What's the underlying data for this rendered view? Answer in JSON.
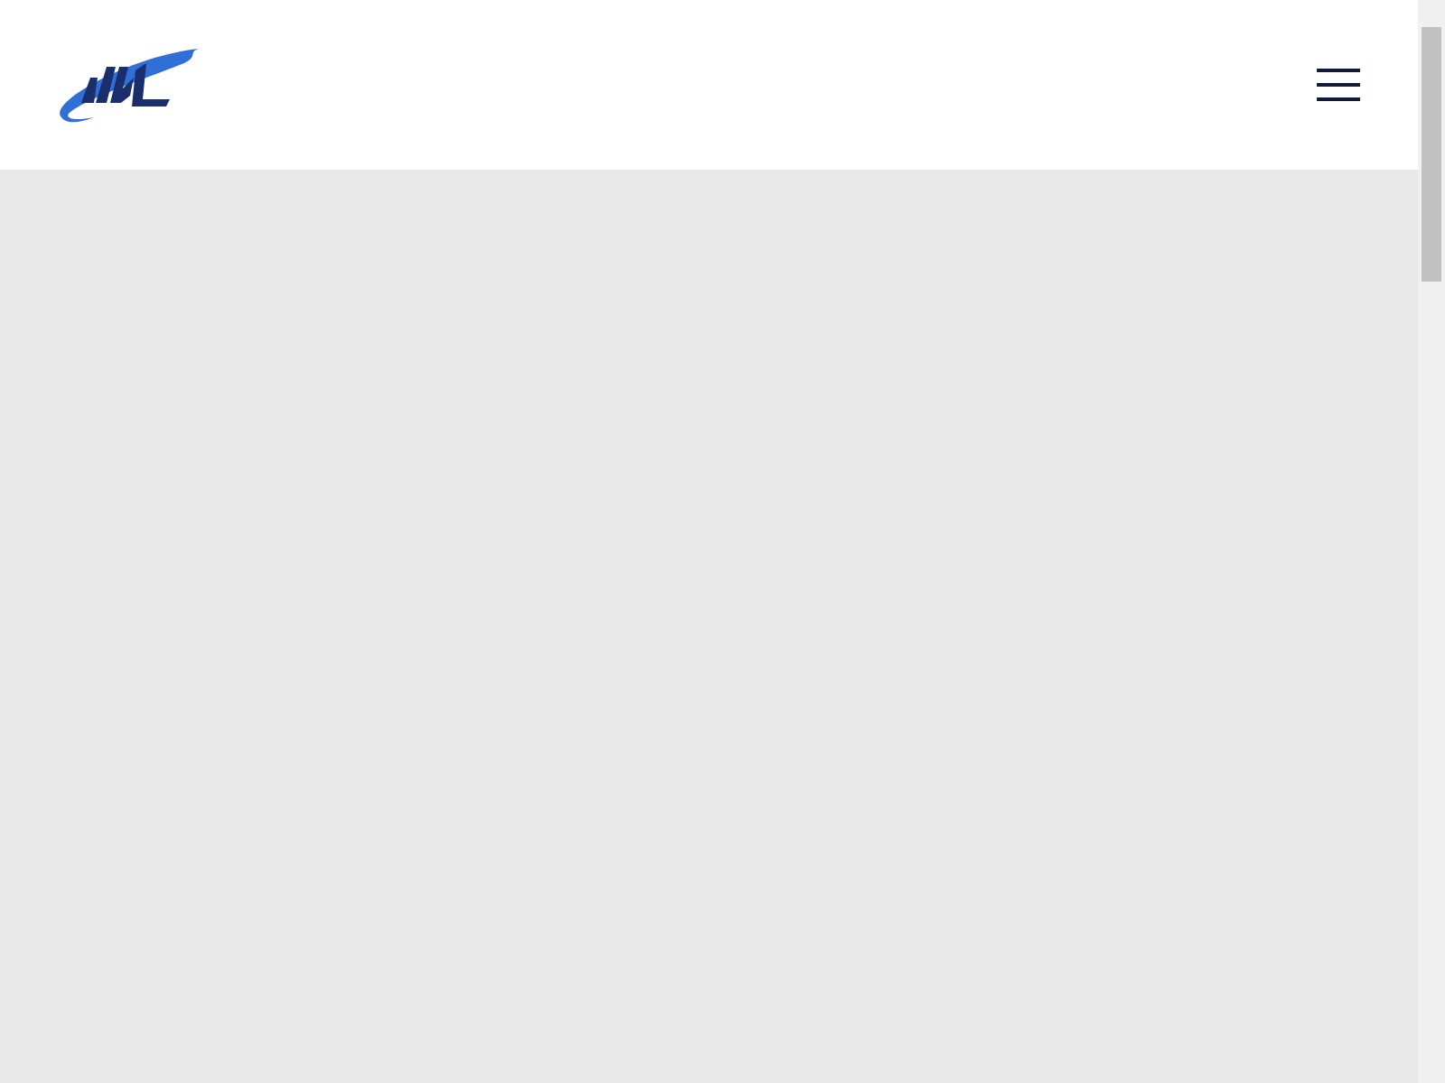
{
  "header": {
    "menu": {
      "expanded": false
    }
  }
}
